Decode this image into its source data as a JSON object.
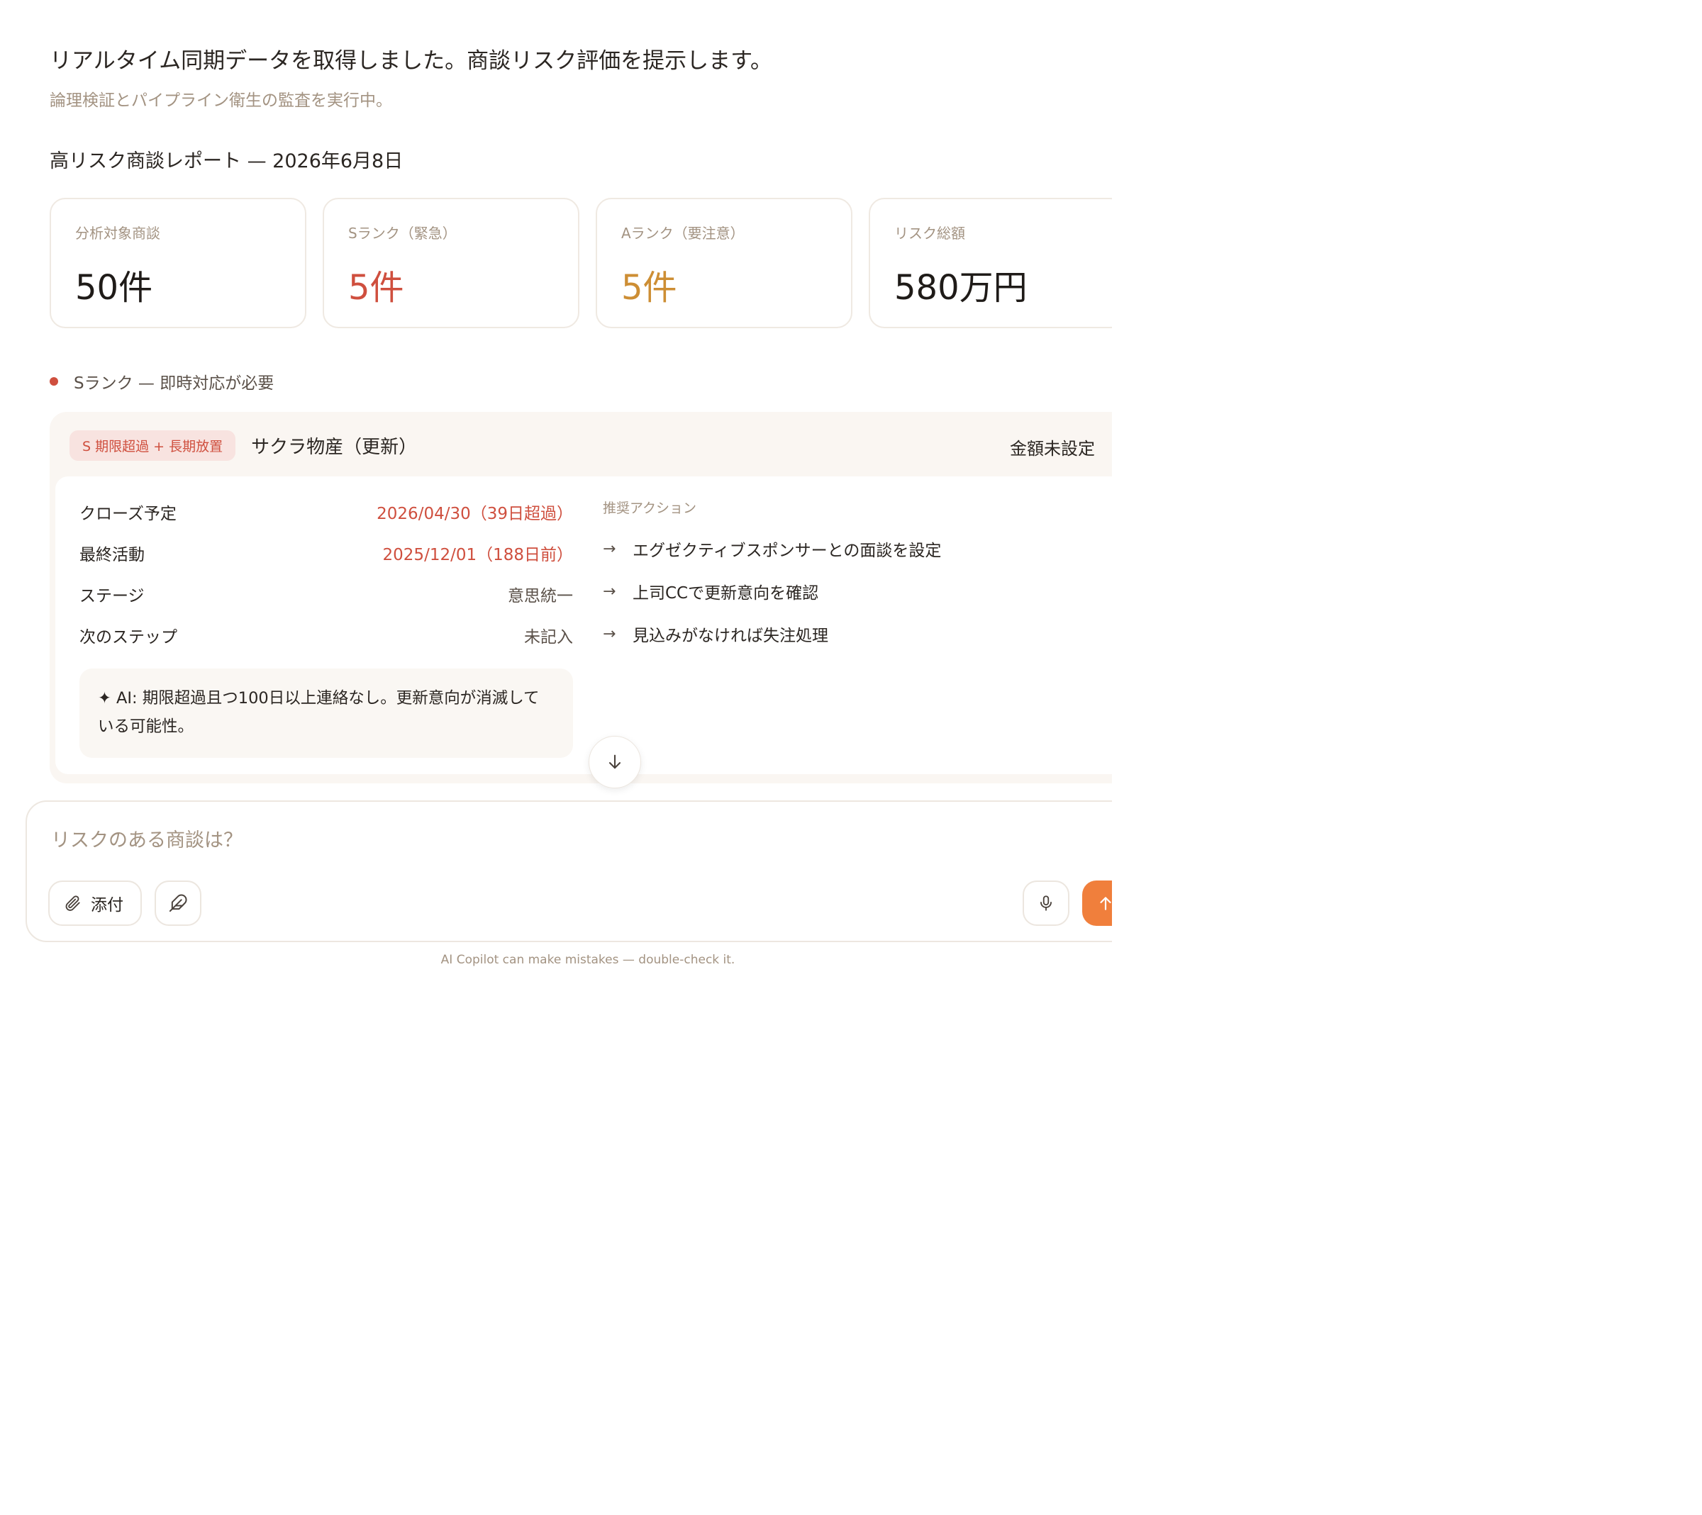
{
  "message": {
    "headline": "リアルタイム同期データを取得しました。商談リスク評価を提示します。",
    "subline": "論理検証とパイプライン衛生の監査を実行中。"
  },
  "report": {
    "title": "高リスク商談レポート — 2026年6月8日",
    "stats": [
      {
        "label": "分析対象商談",
        "value": "50件",
        "tone": "default",
        "color": "#1f1b18"
      },
      {
        "label": "Sランク（緊急）",
        "value": "5件",
        "tone": "danger",
        "color": "#cf4f3e"
      },
      {
        "label": "Aランク（要注意）",
        "value": "5件",
        "tone": "warning",
        "color": "#cd8e34"
      },
      {
        "label": "リスク総額",
        "value": "580万円",
        "tone": "default",
        "color": "#1f1b18"
      }
    ]
  },
  "section": {
    "label": "Sランク — 即時対応が必要",
    "dot_color": "#cf4f3e"
  },
  "deal": {
    "badge": "S 期限超過 + 長期放置",
    "name": "サクラ物産（更新）",
    "amount": "金額未設定",
    "fields": [
      {
        "label": "クローズ予定",
        "value": "2026/04/30（39日超過）",
        "highlight": true
      },
      {
        "label": "最終活動",
        "value": "2025/12/01（188日前）",
        "highlight": true
      },
      {
        "label": "ステージ",
        "value": "意思統一",
        "highlight": false
      },
      {
        "label": "次のステップ",
        "value": "未記入",
        "highlight": false
      }
    ],
    "ai_note": "✦ AI: 期限超過且つ100日以上連絡なし。更新意向が消滅している可能性。",
    "actions_title": "推奨アクション",
    "actions": [
      "エグゼクティブスポンサーとの面談を設定",
      "上司CCで更新意向を確認",
      "見込みがなければ失注処理"
    ]
  },
  "composer": {
    "placeholder": "リスクのある商談は？",
    "attach_label": "添付",
    "accent_color": "#f07f3c"
  },
  "footer": {
    "disclaimer": "AI Copilot can make mistakes — double-check it."
  },
  "icons": {
    "attach": "paperclip-icon",
    "pen": "feather-pen-icon",
    "mic": "microphone-icon",
    "send": "arrow-up-icon",
    "scroll": "arrow-down-icon",
    "action": "arrow-right-icon"
  }
}
